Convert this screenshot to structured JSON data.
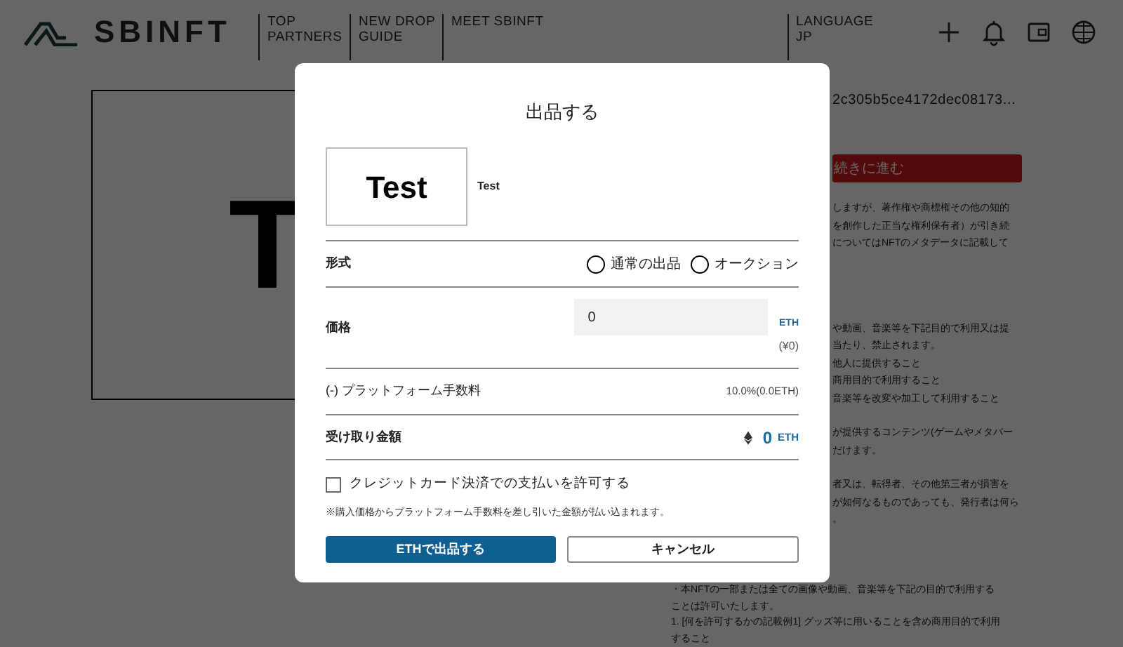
{
  "header": {
    "logo": "SBINFT",
    "nav": [
      {
        "label": "TOP PARTNERS"
      },
      {
        "label": "NEW DROP GUIDE"
      },
      {
        "label": "MEET SBINFT"
      }
    ],
    "language": {
      "label": "LANGUAGE",
      "value": "JP"
    }
  },
  "background": {
    "artwork_text": "T",
    "token_id": "2c305b5ce4172dec08173...",
    "proceed_button": "続きに進む",
    "paragraphs_beside": [
      [
        "しますが、著作権や商標権その他の知的",
        "を創作した正当な権利保有者）が引き続",
        "についてはNFTのメタデータに記載して"
      ],
      [
        "や動画、音楽等を下記目的で利用又は提",
        "当たり、禁止されます。",
        "他人に提供すること",
        "商用目的で利用すること",
        "音楽等を改変や加工して利用すること"
      ],
      [
        "が提供するコンテンツ(ゲームやメタバー",
        "だけます。"
      ],
      [
        "者又は、転得者、その他第三者が損害を",
        "が如何なるものであっても、発行者は何ら",
        "。"
      ]
    ],
    "lines_below": [
      "・本NFTの一部または全ての画像や動画、音楽等を下記の目的で利用する",
      "ことは許可いたします。",
      "1. [何を許可するかの記載例1] グッズ等に用いることを含め商用目的で利用",
      "すること"
    ]
  },
  "modal": {
    "title": "出品する",
    "thumbnail_text": "Test",
    "item_name": "Test",
    "format": {
      "label": "形式",
      "options": [
        {
          "label": "通常の出品",
          "selected": false
        },
        {
          "label": "オークション",
          "selected": false
        }
      ]
    },
    "price": {
      "label": "価格",
      "value": "0",
      "unit": "ETH",
      "yen": "(¥0)"
    },
    "fee": {
      "label": "(-) プラットフォーム手数料",
      "value": "10.0%(0.0ETH)"
    },
    "receive": {
      "label": "受け取り金額",
      "amount": "0",
      "unit": "ETH"
    },
    "credit_card": {
      "label": "クレジットカード決済での支払いを許可する",
      "checked": false
    },
    "note": "※購入価格からプラットフォーム手数料を差し引いた金額が払い込まれます。",
    "buttons": [
      {
        "kind": "primary",
        "label": "ETHで出品する"
      },
      {
        "kind": "secondary",
        "label": "キャンセル"
      }
    ]
  }
}
